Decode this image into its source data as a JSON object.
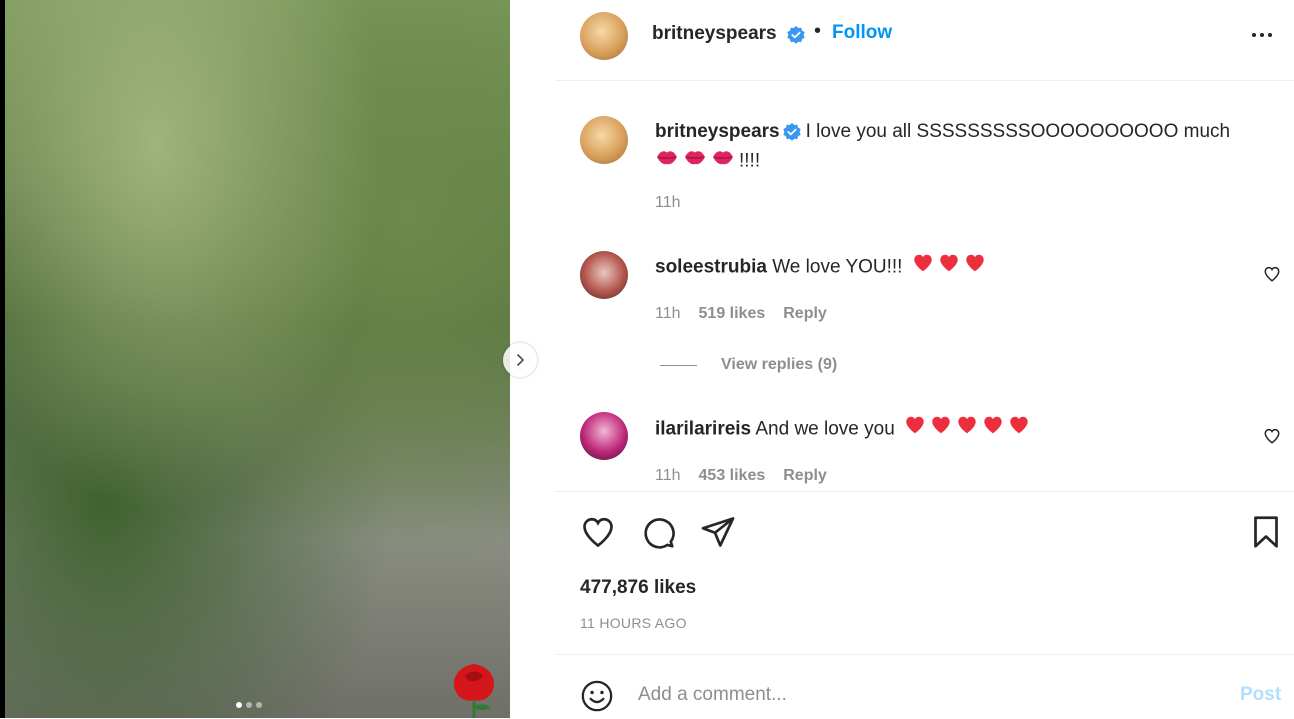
{
  "media": {
    "image_alt": "",
    "carousel_dots": 3,
    "carousel_active_index": 0
  },
  "header": {
    "username": "britneyspears",
    "separator": "•",
    "follow_label": "Follow"
  },
  "caption": {
    "username": "britneyspears",
    "text": "I love you all SSSSSSSSSOOOOOOOOOO much",
    "text_suffix": "!!!!",
    "lips_count": 3,
    "time": "11h"
  },
  "comments": [
    {
      "username": "soleestrubia",
      "text": "We love YOU!!!",
      "hearts": 3,
      "time": "11h",
      "likes": "519 likes",
      "reply_label": "Reply",
      "view_replies": "View replies (9)"
    },
    {
      "username": "ilarilarireis",
      "text": "And we love you",
      "hearts": 5,
      "time": "11h",
      "likes": "453 likes",
      "reply_label": "Reply"
    }
  ],
  "post": {
    "likes": "477,876 likes",
    "time_ago": "11 HOURS AGO"
  },
  "comment_box": {
    "placeholder": "Add a comment...",
    "post_label": "Post"
  },
  "colors": {
    "link_blue": "#0095f6",
    "post_disabled": "#b2dffc",
    "muted": "#8e8e8e",
    "heart_red": "#ed2f3d",
    "verified_blue": "#3897f0"
  },
  "icons": [
    "verified-badge-icon",
    "more-options-icon",
    "heart-icon",
    "comment-icon",
    "share-icon",
    "bookmark-icon",
    "emoji-icon",
    "chevron-right-icon"
  ]
}
